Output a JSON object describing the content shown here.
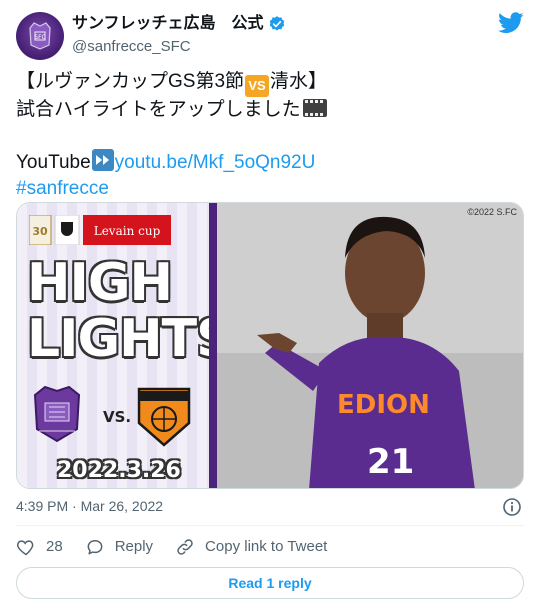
{
  "author": {
    "display_name": "サンフレッチェ広島　公式",
    "handle": "@sanfrecce_SFC",
    "verified": true
  },
  "icons": {
    "brand": "twitter-bird-icon",
    "verified": "verified-badge-icon",
    "info": "info-icon",
    "like": "heart-icon",
    "reply": "speech-bubble-icon",
    "copy_link": "link-icon"
  },
  "tweet": {
    "line1_a": "【ルヴァンカップGS第3節",
    "emoji_vs": "VS",
    "line1_b": "清水】",
    "line2": "試合ハイライトをアップしました",
    "youtube_label": "YouTube",
    "youtube_link": "youtu.be/Mkf_5oQn92U",
    "hashtag": "#sanfrecce"
  },
  "media": {
    "copyright": "©2022 S.FC",
    "cup_name": "Levain cup",
    "anniversary": "30",
    "title_line1": "HIGH",
    "title_line2": "LIGHTS",
    "vs_label": "VS.",
    "match_date": "2022.3.26",
    "player_number": "21",
    "sponsor": "EDION"
  },
  "meta": {
    "timestamp": "4:39 PM · Mar 26, 2022"
  },
  "actions": {
    "like_count": "28",
    "reply_label": "Reply",
    "copy_label": "Copy link to Tweet",
    "read_reply_label": "Read 1 reply"
  },
  "colors": {
    "brand_blue": "#1d9bf0",
    "sanfrecce_purple": "#4b237a",
    "text_secondary": "#536471"
  }
}
